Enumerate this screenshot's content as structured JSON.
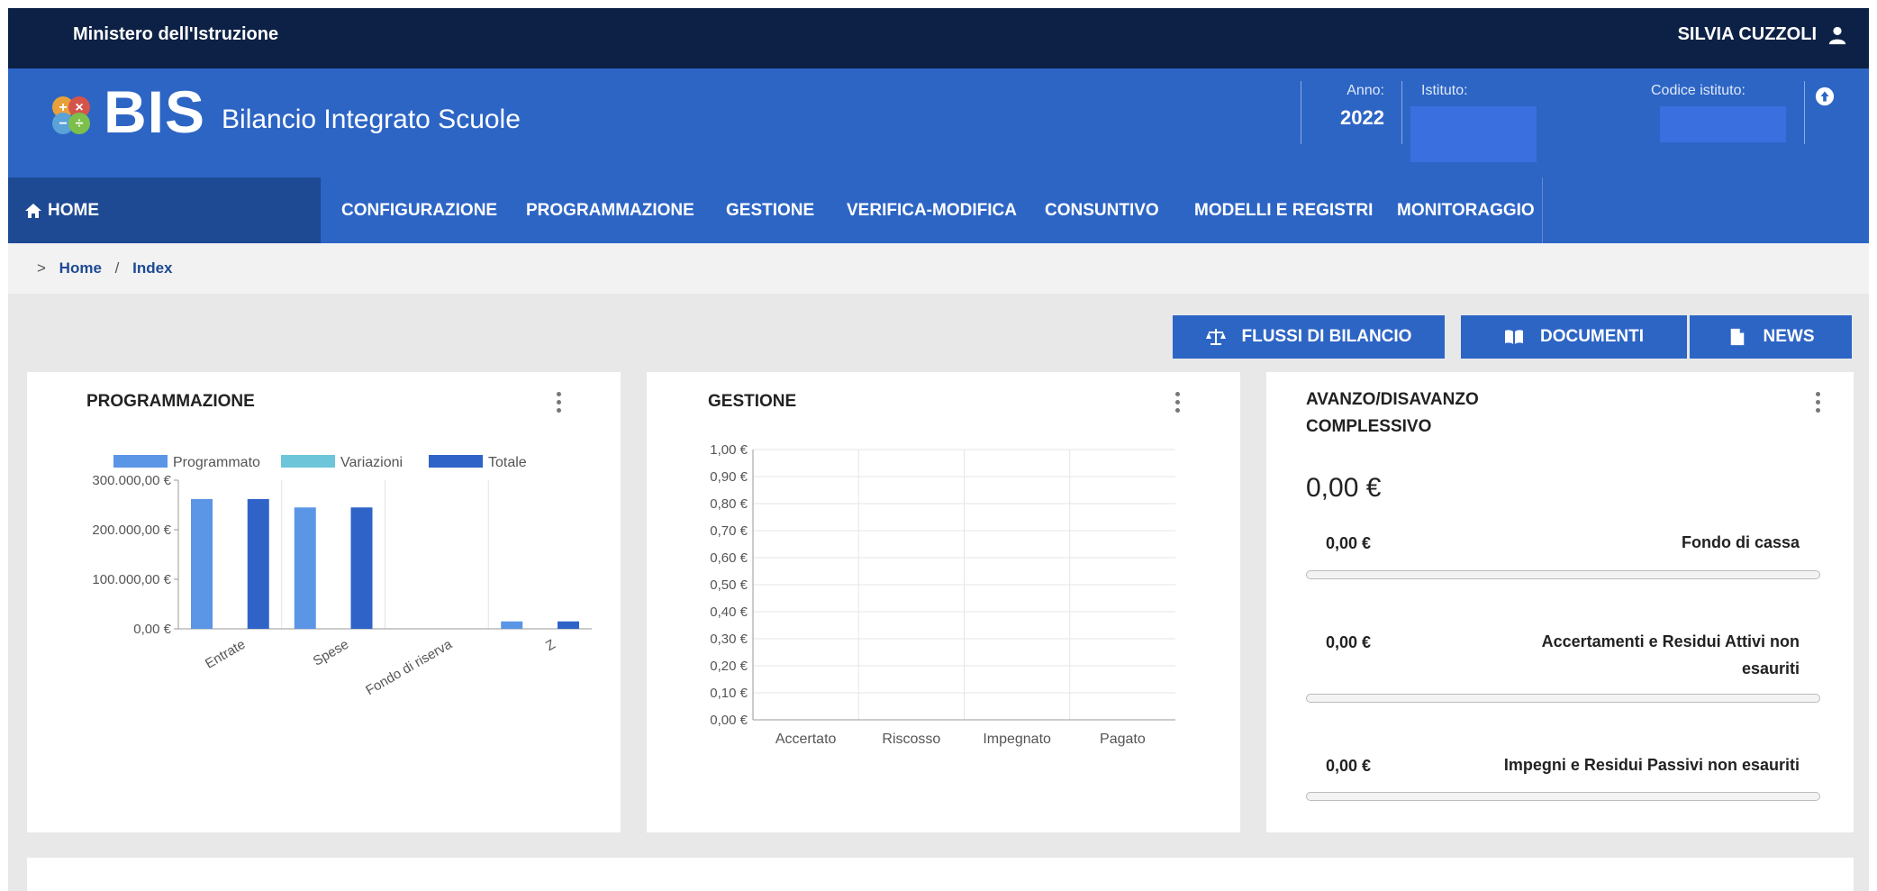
{
  "topbar": {
    "ministry": "Ministero dell'Istruzione",
    "user_name": "SILVIA CUZZOLI"
  },
  "header": {
    "logo_text": "BIS",
    "logo_subtitle": "Bilancio Integrato Scuole",
    "anno_label": "Anno:",
    "anno_value": "2022",
    "istituto_label": "Istituto:",
    "codice_label": "Codice istituto:"
  },
  "nav": {
    "items": [
      {
        "label": "HOME"
      },
      {
        "label": "CONFIGURAZIONE"
      },
      {
        "label": "PROGRAMMAZIONE"
      },
      {
        "label": "GESTIONE"
      },
      {
        "label": "VERIFICA-MODIFICA"
      },
      {
        "label": "CONSUNTIVO"
      },
      {
        "label": "MODELLI E REGISTRI"
      },
      {
        "label": "MONITORAGGIO"
      }
    ]
  },
  "breadcrumb": {
    "gt": ">",
    "home": "Home",
    "separator": "/",
    "current": "Index"
  },
  "actions": {
    "flussi": "FLUSSI DI BILANCIO",
    "documenti": "DOCUMENTI",
    "news": "NEWS"
  },
  "programmazione": {
    "title": "PROGRAMMAZIONE"
  },
  "gestione": {
    "title": "GESTIONE"
  },
  "avanzo": {
    "title_line1": "AVANZO/DISAVANZO",
    "title_line2": "COMPLESSIVO",
    "total": "0,00 €",
    "rows": [
      {
        "amount": "0,00 €",
        "label": "Fondo di cassa",
        "progress": 0
      },
      {
        "amount": "0,00 €",
        "label": "Accertamenti e Residui Attivi non esauriti",
        "progress": 0
      },
      {
        "amount": "0,00 €",
        "label": "Impegni e Residui Passivi non esauriti",
        "progress": 0
      }
    ]
  },
  "colors": {
    "topbar": "#0d2146",
    "primary": "#2d65c5",
    "nav_active": "#1e4a94",
    "series_programmato": "#5b95e6",
    "series_variazioni": "#6cc5d8",
    "series_totale": "#2f63c8"
  },
  "chart_data": [
    {
      "type": "bar",
      "title": "PROGRAMMAZIONE",
      "categories": [
        "Entrate",
        "Spese",
        "Fondo di riserva",
        "Z"
      ],
      "series": [
        {
          "name": "Programmato",
          "values": [
            262000,
            245000,
            0,
            15000
          ]
        },
        {
          "name": "Variazioni",
          "values": [
            0,
            0,
            0,
            0
          ]
        },
        {
          "name": "Totale",
          "values": [
            262000,
            245000,
            0,
            15000
          ]
        }
      ],
      "y_ticks": [
        "300.000,00 €",
        "200.000,00 €",
        "100.000,00 €",
        "0,00 €"
      ],
      "ylim": [
        0,
        300000
      ],
      "legend": "top"
    },
    {
      "type": "bar",
      "title": "GESTIONE",
      "categories": [
        "Accertato",
        "Riscosso",
        "Impegnato",
        "Pagato"
      ],
      "series": [
        {
          "values": [
            0,
            0,
            0,
            0
          ]
        }
      ],
      "y_ticks": [
        "1,00 €",
        "0,90 €",
        "0,80 €",
        "0,70 €",
        "0,60 €",
        "0,50 €",
        "0,40 €",
        "0,30 €",
        "0,20 €",
        "0,10 €",
        "0,00 €"
      ],
      "ylim": [
        0,
        1
      ],
      "grid": true
    }
  ]
}
